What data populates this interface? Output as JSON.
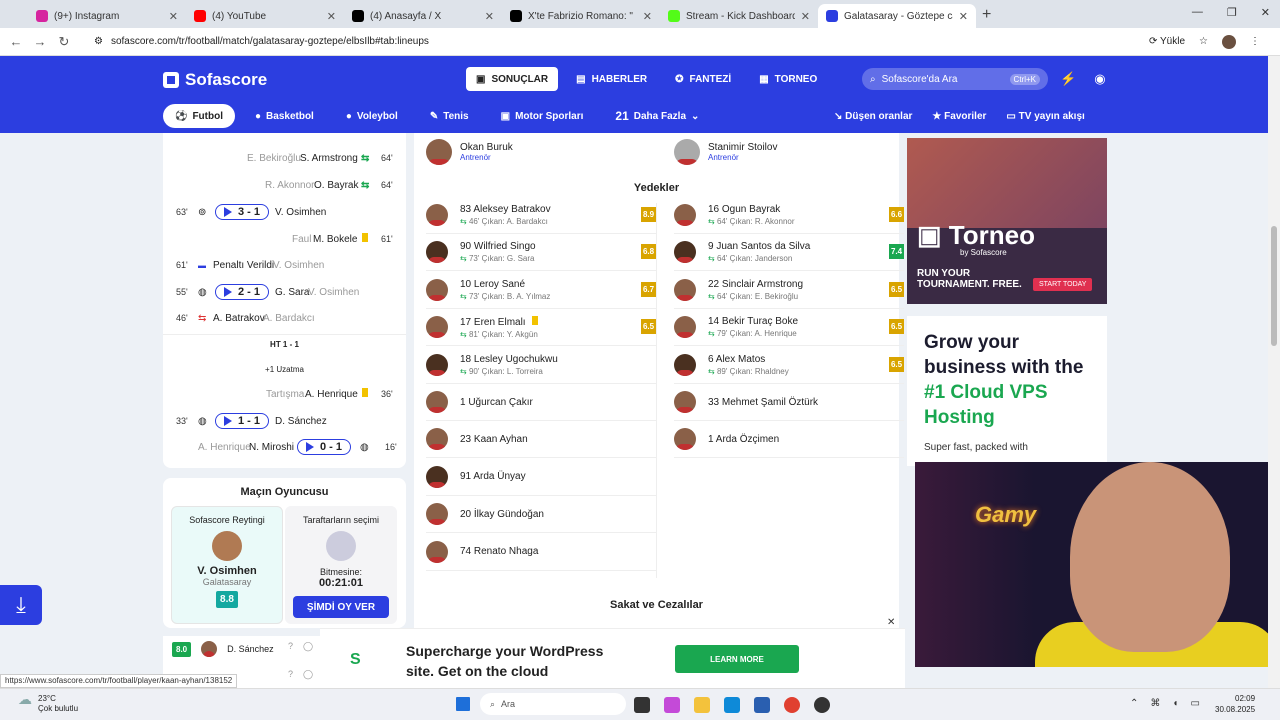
{
  "browser": {
    "tabs": [
      {
        "title": "(9+) Instagram",
        "color": "#d6249f"
      },
      {
        "title": "(4) YouTube",
        "color": "#ff0000"
      },
      {
        "title": "(4) Anasayfa / X",
        "color": "#000000"
      },
      {
        "title": "X'te Fabrizio Romano: \" 🔺 ✪",
        "color": "#000000"
      },
      {
        "title": "Stream - Kick Dashboard",
        "color": "#53fc18"
      },
      {
        "title": "Galatasaray - Göztepe canlı skor",
        "color": "#2c3ee0"
      }
    ],
    "url": "sofascore.com/tr/football/match/galatasaray-goztepe/elbsIlb#tab:lineups",
    "reload_label": "Yükle"
  },
  "app": {
    "logo": "Sofascore",
    "topnav": [
      "SONUÇLAR",
      "HABERLER",
      "FANTEZİ",
      "TORNEO"
    ],
    "search_placeholder": "Sofascore'da Ara",
    "search_kb": "Ctrl+K",
    "sports": [
      "Futbol",
      "Basketbol",
      "Voleybol",
      "Tenis",
      "Motor Sporları",
      "Daha Fazla"
    ],
    "more_count": "21",
    "rightnav": [
      "Düşen oranlar",
      "Favoriler",
      "TV yayın akışı"
    ]
  },
  "events": {
    "e1": {
      "left": "E. Bekiroğlu",
      "right": "S. Armstrong",
      "min": "64'"
    },
    "e2": {
      "left": "R. Akonnor",
      "right": "O. Bayrak",
      "min": "64'"
    },
    "e3": {
      "min": "63'",
      "score": "3 - 1",
      "player": "V. Osimhen"
    },
    "e4": {
      "label": "Faul",
      "player": "M. Bokele",
      "min": "61'"
    },
    "e5": {
      "min": "61'",
      "label": "Penaltı Verildi",
      "player": "V. Osimhen"
    },
    "e6": {
      "min": "55'",
      "score": "2 - 1",
      "player": "G. Sara",
      "assist": "V. Osimhen"
    },
    "e7": {
      "min": "46'",
      "player": "A. Batrakov",
      "assist": "A. Bardakcı"
    },
    "ht": "HT 1 - 1",
    "extra": "+1 Uzatma",
    "e8": {
      "label": "Tartışma",
      "player": "A. Henrique",
      "min": "36'"
    },
    "e9": {
      "min": "33'",
      "score": "1 - 1",
      "player": "D. Sánchez"
    },
    "e10": {
      "assist": "A. Henrique",
      "player": "N. Miroshi",
      "score": "0 - 1",
      "min": "16'"
    }
  },
  "player_of_match": {
    "title": "Maçın Oyuncusu",
    "rating_label": "Sofascore Reytingi",
    "player": "V. Osimhen",
    "team": "Galatasaray",
    "rating": "8.8",
    "fans_label": "Taraftarların seçimi",
    "ends_label": "Bitmesine:",
    "countdown": "00:21:01",
    "vote_button": "ŞİMDİ OY VER"
  },
  "mini_players": [
    {
      "rating": "8.0",
      "name": "D. Sánchez"
    },
    {
      "rating": "",
      "name": ""
    }
  ],
  "lineups": {
    "coach_home": {
      "name": "Okan Buruk",
      "role": "Antrenör"
    },
    "coach_away": {
      "name": "Stanimir Stoilov",
      "role": "Antrenör"
    },
    "subs_title": "Yedekler",
    "home_subs": [
      {
        "name": "83 Aleksey Batrakov",
        "sub": "46' Çıkan: A. Bardakcı",
        "rating": "8.9",
        "color": "#d9a400"
      },
      {
        "name": "90 Wilfried Singo",
        "sub": "73' Çıkan: G. Sara",
        "rating": "6.8",
        "color": "#d9a400"
      },
      {
        "name": "10 Leroy Sané",
        "sub": "73' Çıkan: B. A. Yılmaz",
        "rating": "6.7",
        "color": "#d9a400"
      },
      {
        "name": "17 Eren Elmalı",
        "sub": "81' Çıkan: Y. Akgün",
        "rating": "6.5",
        "color": "#d9a400",
        "card": "yellow"
      },
      {
        "name": "18 Lesley Ugochukwu",
        "sub": "90' Çıkan: L. Torreira",
        "rating": "",
        "color": ""
      },
      {
        "name": "1 Uğurcan Çakır",
        "sub": "",
        "rating": "",
        "color": ""
      },
      {
        "name": "23 Kaan Ayhan",
        "sub": "",
        "rating": "",
        "color": ""
      },
      {
        "name": "91 Arda Ünyay",
        "sub": "",
        "rating": "",
        "color": ""
      },
      {
        "name": "20 İlkay Gündoğan",
        "sub": "",
        "rating": "",
        "color": ""
      },
      {
        "name": "74 Renato Nhaga",
        "sub": "",
        "rating": "",
        "color": ""
      }
    ],
    "away_subs": [
      {
        "name": "16 Ogun Bayrak",
        "sub": "64' Çıkan: R. Akonnor",
        "rating": "6.6",
        "color": "#d9a400"
      },
      {
        "name": "9 Juan Santos da Silva",
        "sub": "64' Çıkan: Janderson",
        "rating": "7.4",
        "color": "#1aa750"
      },
      {
        "name": "22 Sinclair Armstrong",
        "sub": "64' Çıkan: E. Bekiroğlu",
        "rating": "6.5",
        "color": "#d9a400"
      },
      {
        "name": "14 Bekir Turaç Boke",
        "sub": "79' Çıkan: A. Henrique",
        "rating": "6.5",
        "color": "#d9a400"
      },
      {
        "name": "6 Alex Matos",
        "sub": "89' Çıkan: Rhaldney",
        "rating": "6.5",
        "color": "#d9a400"
      },
      {
        "name": "33 Mehmet Şamil Öztürk",
        "sub": "",
        "rating": "",
        "color": ""
      },
      {
        "name": "1 Arda Özçimen",
        "sub": "",
        "rating": "",
        "color": ""
      }
    ],
    "injuries_title": "Sakat ve Cezalılar"
  },
  "ads": {
    "torneo_brand": "Torneo",
    "torneo_by": "by Sofascore",
    "torneo_line1": "RUN YOUR",
    "torneo_line2": "TOURNAMENT. FREE.",
    "torneo_cta": "START TODAY",
    "vps_h1": "Grow your business with the ",
    "vps_h2": "#1 Cloud VPS Hosting",
    "vps_p": "Super fast, packed with",
    "banner_line1": "Supercharge your WordPress",
    "banner_line2": "site. Get on the cloud",
    "banner_cta": "LEARN MORE"
  },
  "status_url": "https://www.sofascore.com/tr/football/player/kaan-ayhan/138152",
  "taskbar": {
    "temp": "23°C",
    "weather": "Çok bulutlu",
    "search": "Ara",
    "time": "02:09",
    "date": "30.08.2025"
  }
}
